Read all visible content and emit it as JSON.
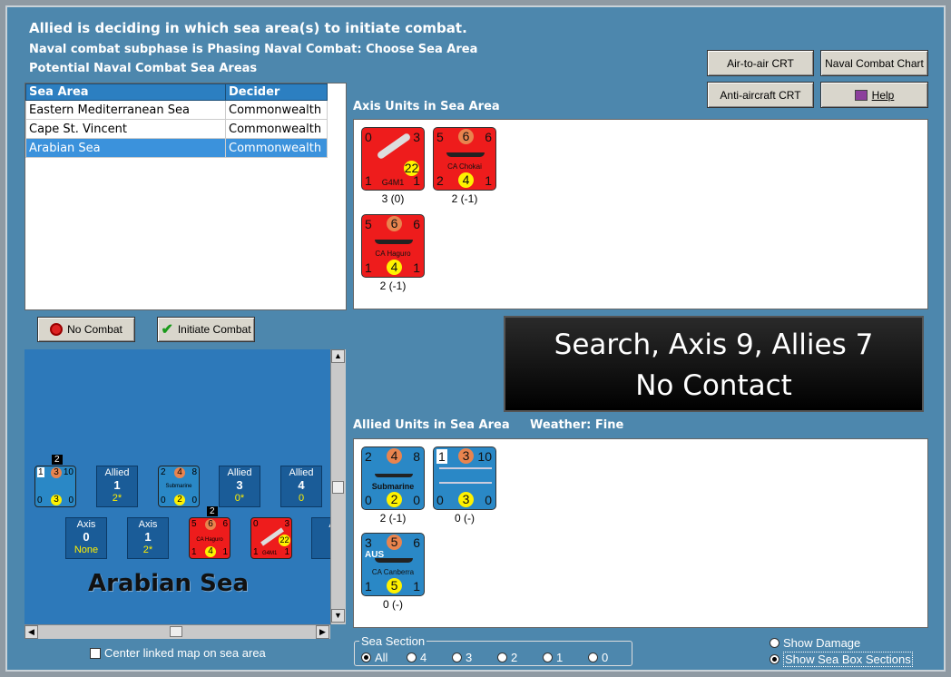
{
  "header": {
    "line1": "Allied is deciding in which sea area(s) to initiate combat.",
    "line2": "Naval combat subphase is Phasing Naval Combat: Choose Sea Area",
    "line3": "Potential Naval Combat Sea Areas"
  },
  "buttons": {
    "air_to_air": "Air-to-air CRT",
    "naval_chart": "Naval Combat Chart",
    "anti_aircraft": "Anti-aircraft CRT",
    "help": "Help",
    "no_combat": "No Combat",
    "initiate": "Initiate Combat"
  },
  "table": {
    "headers": [
      "Sea Area",
      "Decider"
    ],
    "rows": [
      [
        "Eastern Mediterranean Sea",
        "Commonwealth"
      ],
      [
        "Cape St. Vincent",
        "Commonwealth"
      ],
      [
        "Arabian Sea",
        "Commonwealth"
      ]
    ]
  },
  "axis_title": "Axis Units in Sea Area",
  "allied_title": "Allied Units in Sea Area",
  "weather": "Weather:  Fine",
  "overlay": {
    "line1": "Search, Axis 9, Allies 7",
    "line2": "No Contact"
  },
  "axis_units": [
    {
      "tl": "0",
      "tr": "3",
      "tc": "",
      "bl": "1",
      "br": "1",
      "bc": "22",
      "name": "G4M1",
      "cap": "3 (0)"
    },
    {
      "tl": "5",
      "tr": "6",
      "tc": "6",
      "bl": "2",
      "br": "1",
      "bc": "4",
      "name": "CA Chokai",
      "cap": "2 (-1)"
    },
    {
      "tl": "5",
      "tr": "6",
      "tc": "6",
      "bl": "1",
      "br": "1",
      "bc": "4",
      "name": "CA Haguro",
      "cap": "2 (-1)"
    }
  ],
  "allied_units": [
    {
      "tl": "2",
      "tr": "8",
      "tc": "4",
      "bl": "0",
      "br": "0",
      "bc": "2",
      "name": "Submarine",
      "cap": "2 (-1)"
    },
    {
      "tl": "1",
      "tr": "10",
      "tc": "3",
      "bl": "0",
      "br": "0",
      "bc": "3",
      "name": "",
      "cap": "0 (-)"
    },
    {
      "tl": "3",
      "tr": "6",
      "tc": "5",
      "bl": "1",
      "br": "1",
      "bc": "5",
      "name": "CA Canberra",
      "nation": "AUS",
      "cap": "0 (-)"
    }
  ],
  "map": {
    "title": "Arabian Sea",
    "allied_boxes": [
      {
        "label": "Allied",
        "n": "1",
        "sub": "2*"
      },
      {
        "label": "Allied",
        "n": "3",
        "sub": "0*"
      },
      {
        "label": "Allied",
        "n": "4",
        "sub": "0"
      }
    ],
    "axis_boxes": [
      {
        "label": "Axis",
        "n": "0",
        "sub": "None"
      },
      {
        "label": "Axis",
        "n": "1",
        "sub": "2*"
      }
    ],
    "stack_a": "2",
    "stack_b": "2",
    "mini_allied1": {
      "tl": "1",
      "tc": "3",
      "tr": "10",
      "bl": "0",
      "bc": "3",
      "br": "0"
    },
    "mini_allied2": {
      "tl": "2",
      "tc": "4",
      "tr": "8",
      "bl": "0",
      "bc": "2",
      "br": "0",
      "name": "Submarine"
    },
    "mini_axis1": {
      "tl": "5",
      "tc": "6",
      "tr": "6",
      "bl": "1",
      "bc": "4",
      "br": "1",
      "name": "CA Haguro"
    },
    "mini_axis2": {
      "tl": "0",
      "tc": "",
      "tr": "3",
      "bl": "1",
      "bc": "22",
      "br": "1",
      "name": "G4M1"
    },
    "partial_box": "A"
  },
  "center_linked": "Center linked map on sea area",
  "sea_section": {
    "legend": "Sea Section",
    "options": [
      "All",
      "4",
      "3",
      "2",
      "1",
      "0"
    ]
  },
  "show_damage": "Show Damage",
  "show_sections": "Show Sea Box Sections"
}
